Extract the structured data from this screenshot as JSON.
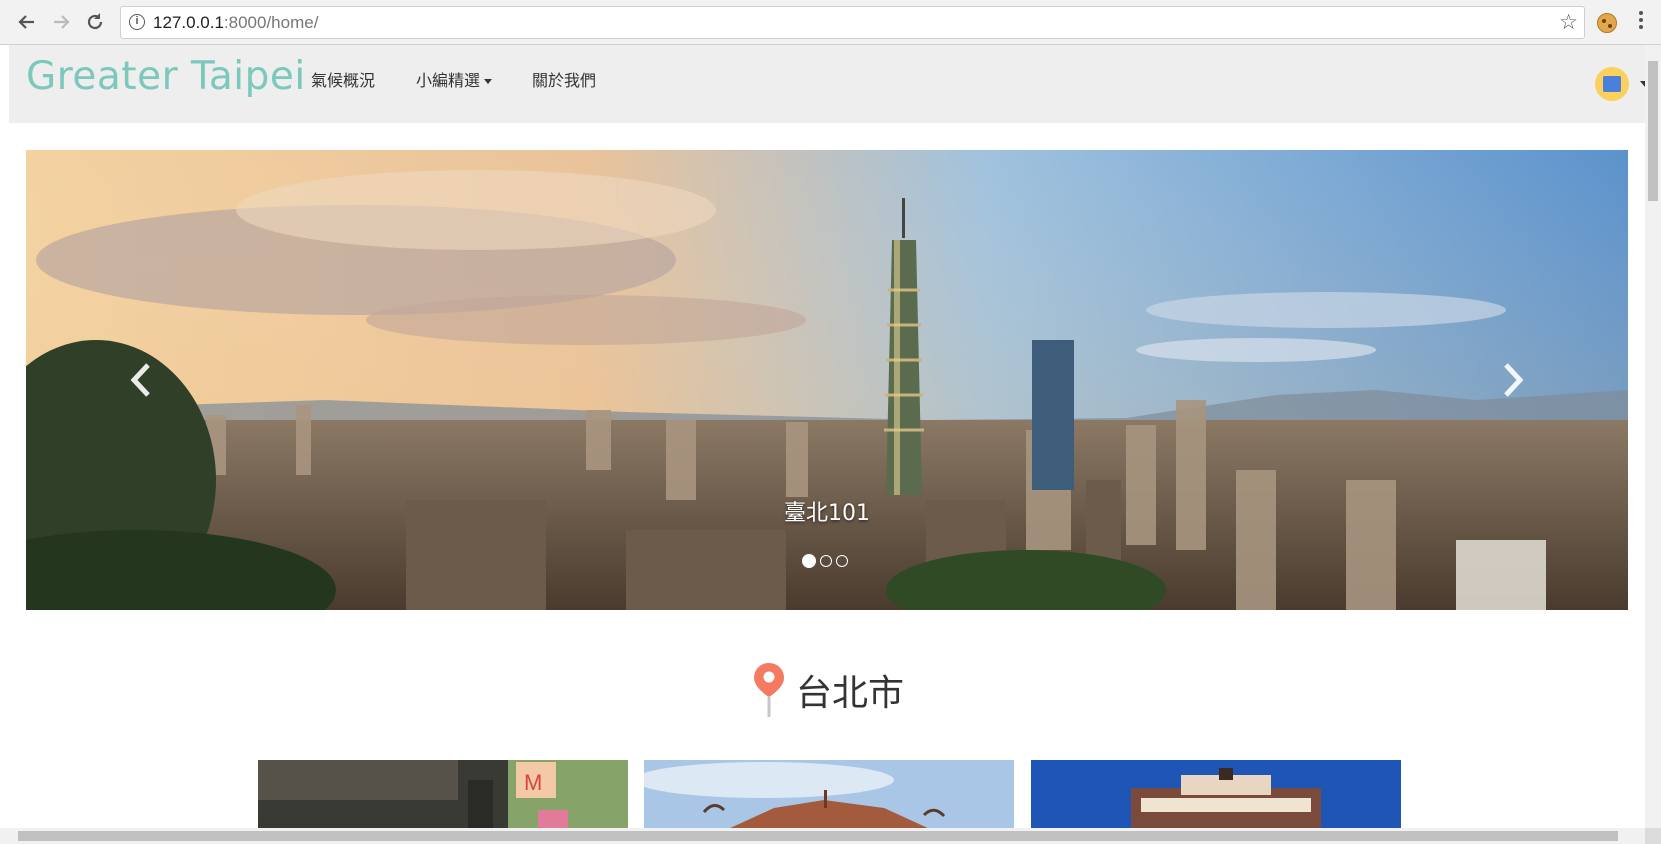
{
  "browser": {
    "url_host": "127.0.0.1",
    "url_path": ":8000/home/"
  },
  "navbar": {
    "brand": "Greater Taipei",
    "items": [
      {
        "label": "氣候概況"
      },
      {
        "label": "小編精選",
        "has_dropdown": true
      },
      {
        "label": "關於我們"
      }
    ]
  },
  "carousel": {
    "caption": "臺北101",
    "slide_count": 3,
    "active_index": 0
  },
  "section": {
    "title": "台北市"
  },
  "colors": {
    "brand": "#7cc8bd",
    "navbar_bg": "#eeeeee",
    "pin": "#f47b62"
  }
}
